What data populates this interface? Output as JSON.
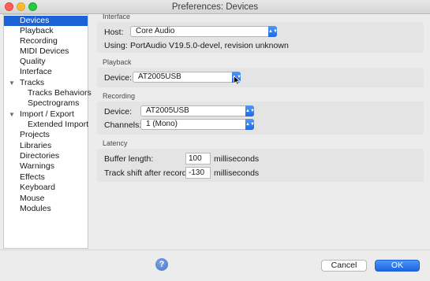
{
  "window": {
    "title": "Preferences: Devices"
  },
  "sidebar": {
    "items": [
      {
        "label": "Devices",
        "selected": true
      },
      {
        "label": "Playback"
      },
      {
        "label": "Recording"
      },
      {
        "label": "MIDI Devices"
      },
      {
        "label": "Quality"
      },
      {
        "label": "Interface"
      },
      {
        "label": "Tracks",
        "expanded": true
      },
      {
        "label": "Tracks Behaviors"
      },
      {
        "label": "Spectrograms"
      },
      {
        "label": "Import / Export",
        "expanded": true
      },
      {
        "label": "Extended Import"
      },
      {
        "label": "Projects"
      },
      {
        "label": "Libraries"
      },
      {
        "label": "Directories"
      },
      {
        "label": "Warnings"
      },
      {
        "label": "Effects"
      },
      {
        "label": "Keyboard"
      },
      {
        "label": "Mouse"
      },
      {
        "label": "Modules"
      }
    ]
  },
  "interface": {
    "section": "Interface",
    "host_label": "Host:",
    "host_value": "Core Audio",
    "using_label": "Using:",
    "using_value": "PortAudio V19.5.0-devel, revision unknown"
  },
  "playback": {
    "section": "Playback",
    "device_label": "Device:",
    "device_value": "AT2005USB"
  },
  "recording": {
    "section": "Recording",
    "device_label": "Device:",
    "device_value": "AT2005USB",
    "channels_label": "Channels:",
    "channels_value": "1 (Mono)"
  },
  "latency": {
    "section": "Latency",
    "buffer_label": "Buffer length:",
    "buffer_value": "100",
    "buffer_unit": "milliseconds",
    "shift_label": "Track shift after record:",
    "shift_value": "-130",
    "shift_unit": "milliseconds"
  },
  "footer": {
    "help": "?",
    "cancel": "Cancel",
    "ok": "OK"
  },
  "colors": {
    "selection": "#1b62d6",
    "accent": "#1e69e3"
  },
  "icons": [
    "close-icon",
    "minimize-icon",
    "maximize-icon",
    "expand-triangle-icon",
    "popup-arrows-icon",
    "help-icon",
    "mouse-cursor-icon"
  ]
}
